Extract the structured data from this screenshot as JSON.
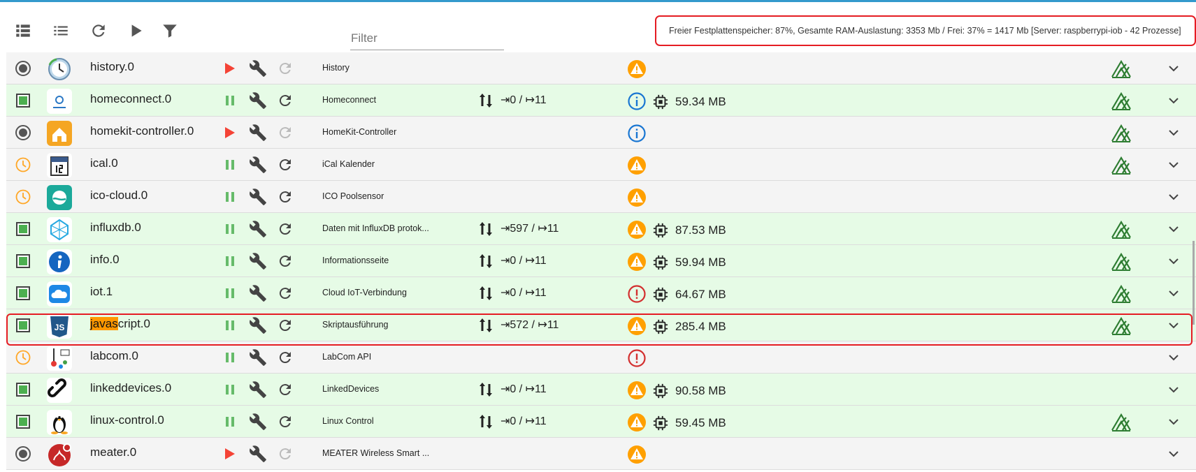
{
  "toolbar": {
    "filter_placeholder": "Filter",
    "status_text": "Freier Festplattenspeicher: 87%, Gesamte RAM-Auslastung: 3353 Mb / Frei: 37% = 1417 Mb [Server: raspberrypi-iob - 42 Prozesse]",
    "icons": [
      "view-list-icon",
      "view-compact-icon",
      "refresh-icon",
      "play-icon",
      "filter-icon"
    ]
  },
  "colors": {
    "top_bar": "#3399cc",
    "active_row": "#e6fbe6",
    "inactive_row": "#f4f4f4",
    "warning": "#ffa000",
    "error": "#d32f2f",
    "info": "#1976d2",
    "connected": "#2e7d32",
    "highlight": "#ff9800",
    "selection_border": "#e51c23"
  },
  "rows": [
    {
      "name": "history.0",
      "title": "History",
      "status": "stopped",
      "running": false,
      "severity": "warning",
      "io": "",
      "memory": "",
      "connected": true
    },
    {
      "name": "homeconnect.0",
      "title": "Homeconnect",
      "status": "running",
      "running": true,
      "severity": "info",
      "io": "⇥0 / ↦11",
      "memory": "59.34 MB",
      "connected": true
    },
    {
      "name": "homekit-controller.0",
      "title": "HomeKit-Controller",
      "status": "stopped",
      "running": false,
      "severity": "info",
      "io": "",
      "memory": "",
      "connected": true
    },
    {
      "name": "ical.0",
      "title": "iCal Kalender",
      "status": "scheduled",
      "running": true,
      "severity": "warning",
      "io": "",
      "memory": "",
      "connected": true
    },
    {
      "name": "ico-cloud.0",
      "title": "ICO Poolsensor",
      "status": "scheduled",
      "running": true,
      "severity": "warning",
      "io": "",
      "memory": "",
      "connected": false
    },
    {
      "name": "influxdb.0",
      "title": "Daten mit InfluxDB protok...",
      "status": "running",
      "running": true,
      "severity": "warning",
      "io": "⇥597 / ↦11",
      "memory": "87.53 MB",
      "connected": true
    },
    {
      "name": "info.0",
      "title": "Informationsseite",
      "status": "running",
      "running": true,
      "severity": "warning",
      "io": "⇥0 / ↦11",
      "memory": "59.94 MB",
      "connected": true
    },
    {
      "name": "iot.1",
      "title": "Cloud IoT-Verbindung",
      "status": "running",
      "running": true,
      "severity": "error",
      "io": "⇥0 / ↦11",
      "memory": "64.67 MB",
      "connected": true
    },
    {
      "name_highlight": "javas",
      "name_rest": "cript.0",
      "title": "Skriptausführung",
      "status": "running",
      "running": true,
      "severity": "warning",
      "io": "⇥572 / ↦11",
      "memory": "285.4 MB",
      "connected": true
    },
    {
      "name": "labcom.0",
      "title": "LabCom API",
      "status": "scheduled",
      "running": true,
      "severity": "error",
      "io": "",
      "memory": "",
      "connected": false
    },
    {
      "name": "linkeddevices.0",
      "title": "LinkedDevices",
      "status": "running",
      "running": true,
      "severity": "warning",
      "io": "⇥0 / ↦11",
      "memory": "90.58 MB",
      "connected": false
    },
    {
      "name": "linux-control.0",
      "title": "Linux Control",
      "status": "running",
      "running": true,
      "severity": "warning",
      "io": "⇥0 / ↦11",
      "memory": "59.45 MB",
      "connected": true
    },
    {
      "name": "meater.0",
      "title": "MEATER Wireless Smart ...",
      "status": "stopped",
      "running": false,
      "severity": "warning",
      "io": "",
      "memory": "",
      "connected": false
    }
  ],
  "logo_icons": [
    "history-logo-icon",
    "homeconnect-logo-icon",
    "homekit-logo-icon",
    "ical-logo-icon",
    "ico-cloud-logo-icon",
    "influxdb-logo-icon",
    "info-logo-icon",
    "iot-cloud-logo-icon",
    "javascript-logo-icon",
    "labcom-logo-icon",
    "linkeddevices-logo-icon",
    "linux-tux-logo-icon",
    "meater-logo-icon"
  ]
}
